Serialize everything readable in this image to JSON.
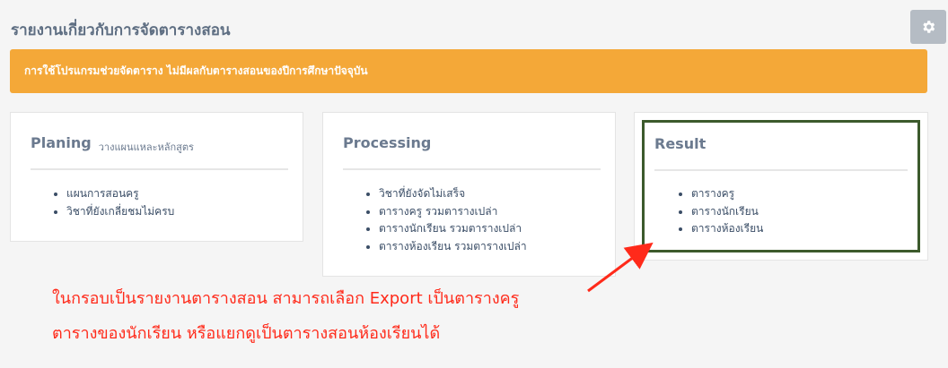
{
  "header": {
    "title": "รายงานเกี่ยวกับการจัดตารางสอน",
    "settings_icon": "gear-icon"
  },
  "alert": {
    "text": "การใช้โปรแกรมช่วยจัดตาราง ไม่มีผลกับตารางสอนของปีการศึกษาปัจจุบัน",
    "color": "#f4a838"
  },
  "cards": {
    "planing": {
      "title": "Planing",
      "subtitle": "วางแผนแหละหลักสูตร",
      "items": [
        "แผนการสอนครู",
        "วิชาที่ยังเกลี่ยชมไม่ครบ"
      ]
    },
    "processing": {
      "title": "Processing",
      "items": [
        "วิชาที่ยังจัดไม่เสร็จ",
        "ตารางครู รวมตารางเปล่า",
        "ตารางนักเรียน รวมตารางเปล่า",
        "ตารางห้องเรียน รวมตารางเปล่า"
      ]
    },
    "result": {
      "title": "Result",
      "items": [
        "ตารางครู",
        "ตารางนักเรียน",
        "ตารางห้องเรียน"
      ],
      "highlight_color": "#3c5a2c"
    }
  },
  "annotation": {
    "line1": "ในกรอบเป็นรายงานตารางสอน สามารถเลือก Export  เป็นตารางครู",
    "line2": "ตารางของนักเรียน หรือแยกดูเป็นตารางสอนห้องเรียนได้",
    "color": "#ff2a1a"
  }
}
